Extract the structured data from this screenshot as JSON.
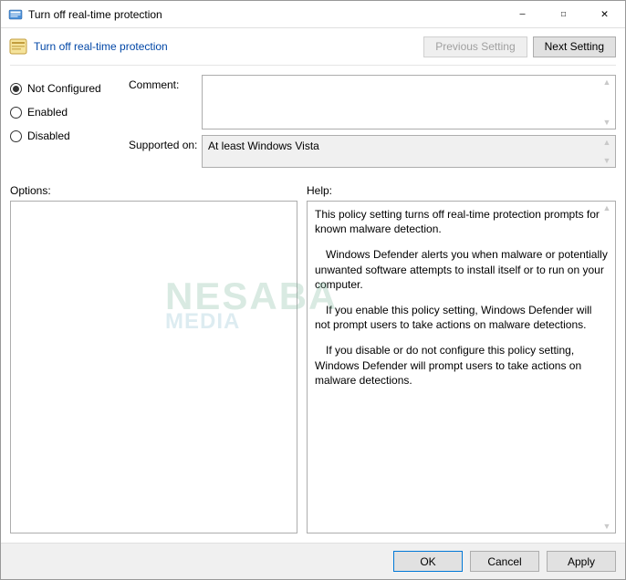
{
  "window": {
    "title": "Turn off real-time protection",
    "minimize": "—",
    "maximize": "☐",
    "close": "✕"
  },
  "header": {
    "title": "Turn off real-time protection",
    "previous": "Previous Setting",
    "next": "Next Setting"
  },
  "state": {
    "options": [
      {
        "label": "Not Configured",
        "checked": true
      },
      {
        "label": "Enabled",
        "checked": false
      },
      {
        "label": "Disabled",
        "checked": false
      }
    ]
  },
  "fields": {
    "comment_label": "Comment:",
    "comment_value": "",
    "supported_label": "Supported on:",
    "supported_value": "At least Windows Vista"
  },
  "panes": {
    "options_label": "Options:",
    "help_label": "Help:"
  },
  "help": {
    "p1": "This policy setting turns off real-time protection prompts for known malware detection.",
    "p2": "Windows Defender alerts you when malware or potentially unwanted software attempts to install itself or to run on your computer.",
    "p3": "If you enable this policy setting, Windows Defender will not prompt users to take actions on malware detections.",
    "p4": "If you disable or do not configure this policy setting, Windows Defender will prompt users to take actions on malware detections."
  },
  "footer": {
    "ok": "OK",
    "cancel": "Cancel",
    "apply": "Apply"
  },
  "watermark": {
    "line1": "NESABA",
    "line2": "MEDIA"
  }
}
